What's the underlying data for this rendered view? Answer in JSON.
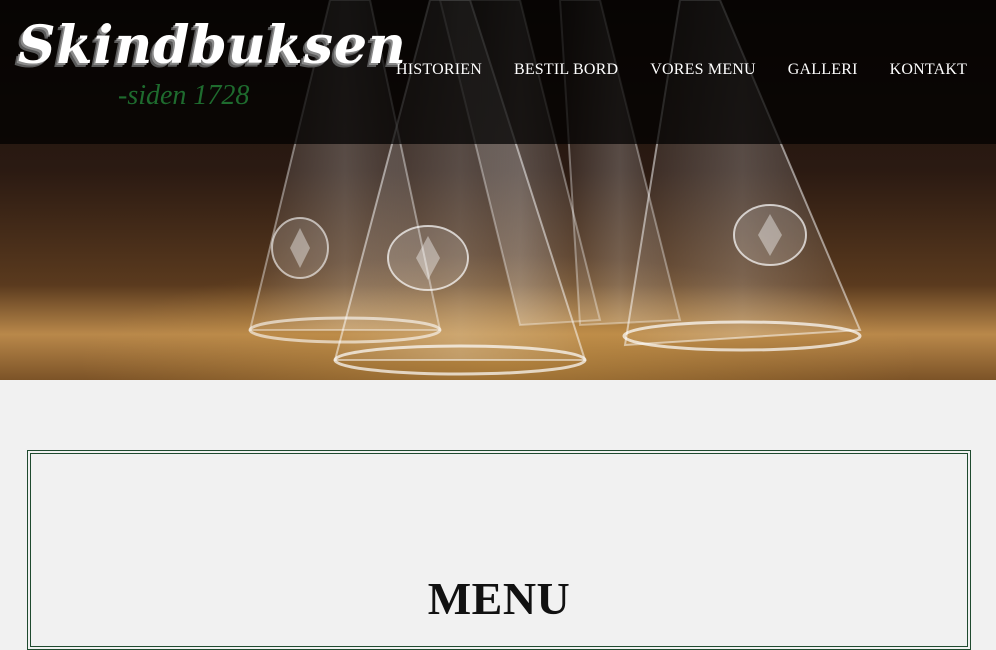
{
  "brand": {
    "name": "Skindbuksen",
    "since": "-siden 1728"
  },
  "nav": {
    "items": [
      {
        "label": "HISTORIEN"
      },
      {
        "label": "BESTIL BORD"
      },
      {
        "label": "VORES MENU"
      },
      {
        "label": "GALLERI"
      },
      {
        "label": "KONTAKT"
      }
    ]
  },
  "hero": {
    "image": "aquavit-glasses-photo"
  },
  "menu_section": {
    "title": "MENU"
  },
  "colors": {
    "logo_green": "#1e6b2e",
    "border_green": "#1f4a2f",
    "page_background": "#f1f1f1"
  }
}
